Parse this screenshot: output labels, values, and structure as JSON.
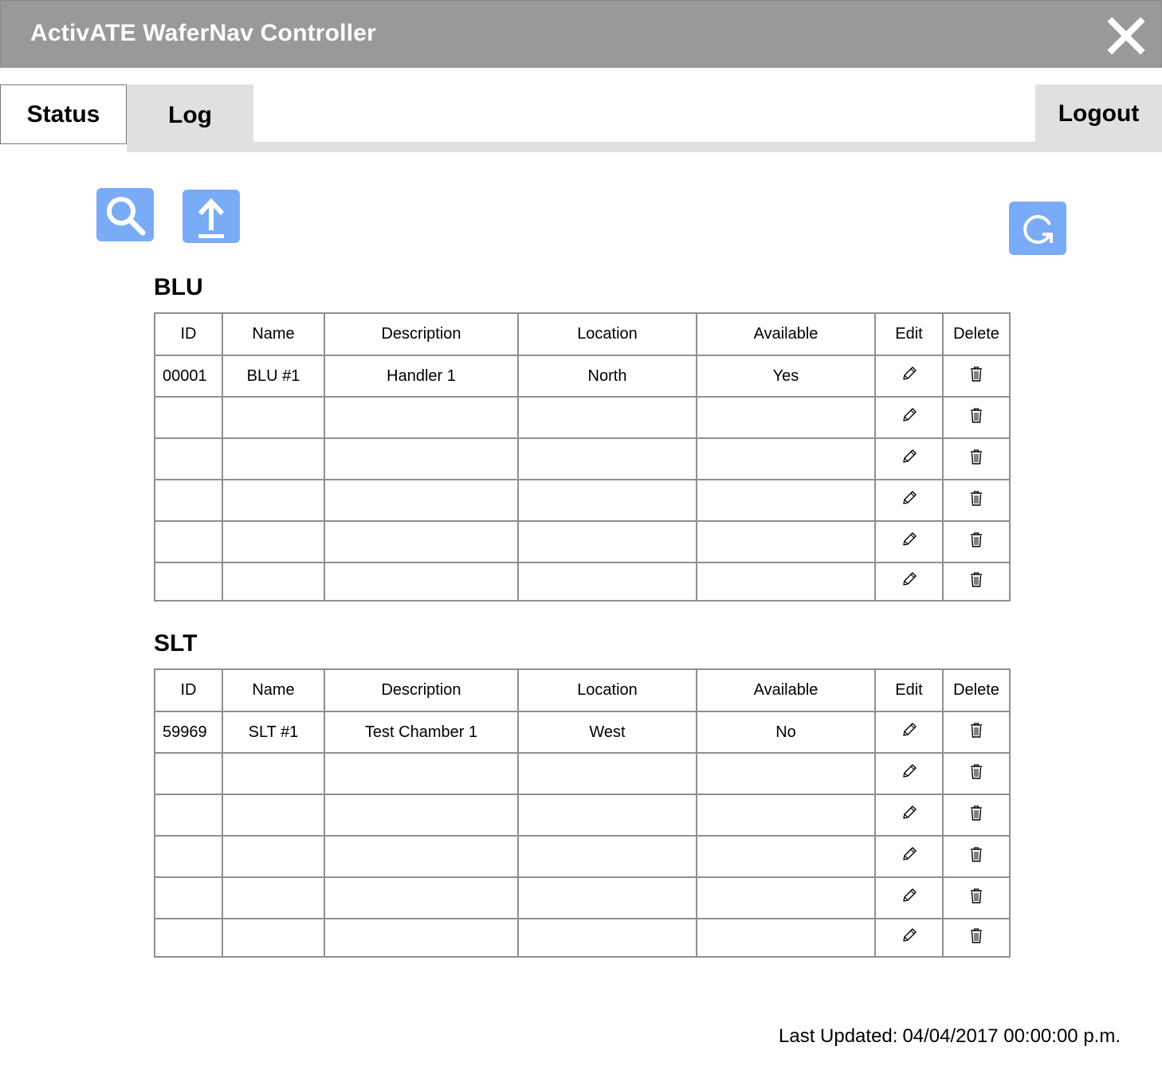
{
  "window": {
    "title": "ActivATE WaferNav Controller",
    "close_icon": "close-x-icon"
  },
  "tabs": {
    "status": "Status",
    "log": "Log",
    "logout": "Logout"
  },
  "toolbar": {
    "search_icon": "search-icon",
    "upload_icon": "upload-icon",
    "refresh_icon": "refresh-icon",
    "button_color": "#7aabf7"
  },
  "columns": [
    "ID",
    "Name",
    "Description",
    "Location",
    "Available",
    "Edit",
    "Delete"
  ],
  "blu": {
    "title": "BLU",
    "rows": [
      {
        "id": "00001",
        "name": "BLU #1",
        "description": "Handler 1",
        "location": "North",
        "available": "Yes"
      },
      {
        "id": "",
        "name": "",
        "description": "",
        "location": "",
        "available": ""
      },
      {
        "id": "",
        "name": "",
        "description": "",
        "location": "",
        "available": ""
      },
      {
        "id": "",
        "name": "",
        "description": "",
        "location": "",
        "available": ""
      },
      {
        "id": "",
        "name": "",
        "description": "",
        "location": "",
        "available": ""
      },
      {
        "id": "",
        "name": "",
        "description": "",
        "location": "",
        "available": ""
      }
    ]
  },
  "slt": {
    "title": "SLT",
    "rows": [
      {
        "id": "59969",
        "name": "SLT #1",
        "description": "Test Chamber 1",
        "location": "West",
        "available": "No"
      },
      {
        "id": "",
        "name": "",
        "description": "",
        "location": "",
        "available": ""
      },
      {
        "id": "",
        "name": "",
        "description": "",
        "location": "",
        "available": ""
      },
      {
        "id": "",
        "name": "",
        "description": "",
        "location": "",
        "available": ""
      },
      {
        "id": "",
        "name": "",
        "description": "",
        "location": "",
        "available": ""
      },
      {
        "id": "",
        "name": "",
        "description": "",
        "location": "",
        "available": ""
      }
    ]
  },
  "footer": {
    "last_updated_label": "Last Updated:",
    "last_updated_value": "04/04/2017 00:00:00 p.m."
  }
}
